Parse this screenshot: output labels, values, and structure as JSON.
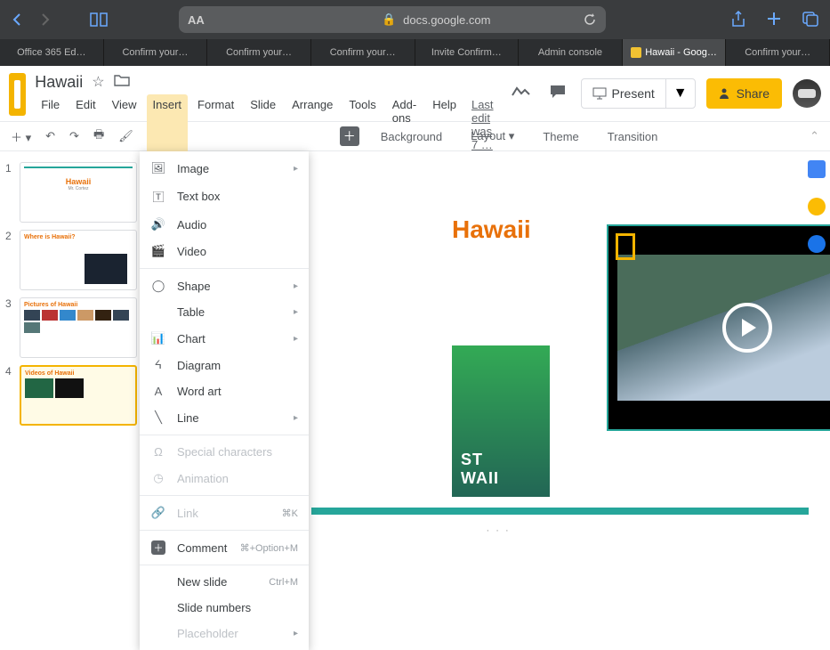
{
  "safari": {
    "url_domain": "docs.google.com",
    "aA": "AA"
  },
  "browser_tabs": [
    {
      "label": "Office 365 Ed…",
      "active": false
    },
    {
      "label": "Confirm your…",
      "active": false
    },
    {
      "label": "Confirm your…",
      "active": false
    },
    {
      "label": "Confirm your…",
      "active": false
    },
    {
      "label": "Invite Confirm…",
      "active": false
    },
    {
      "label": "Admin console",
      "active": false
    },
    {
      "label": "Hawaii - Goog…",
      "active": true
    },
    {
      "label": "Confirm your…",
      "active": false
    }
  ],
  "doc": {
    "title": "Hawaii",
    "last_edit": "Last edit was 7 …"
  },
  "menus": [
    "File",
    "Edit",
    "View",
    "Insert",
    "Format",
    "Slide",
    "Arrange",
    "Tools",
    "Add-ons",
    "Help"
  ],
  "selected_menu_index": 3,
  "toolbar": {
    "background": "Background",
    "layout": "Layout",
    "theme": "Theme",
    "transition": "Transition"
  },
  "header": {
    "present": "Present",
    "share": "Share"
  },
  "insert_menu": [
    {
      "icon": "image-icon",
      "label": "Image",
      "submenu": true
    },
    {
      "icon": "textbox-icon",
      "label": "Text box"
    },
    {
      "icon": "audio-icon",
      "label": "Audio"
    },
    {
      "icon": "video-icon",
      "label": "Video"
    },
    {
      "sep": true
    },
    {
      "icon": "shape-icon",
      "label": "Shape",
      "submenu": true
    },
    {
      "icon": "table-icon",
      "label": "Table",
      "submenu": true,
      "indent": true
    },
    {
      "icon": "chart-icon",
      "label": "Chart",
      "submenu": true
    },
    {
      "icon": "diagram-icon",
      "label": "Diagram"
    },
    {
      "icon": "wordart-icon",
      "label": "Word art"
    },
    {
      "icon": "line-icon",
      "label": "Line",
      "submenu": true
    },
    {
      "sep": true
    },
    {
      "icon": "omega-icon",
      "label": "Special characters",
      "disabled": true
    },
    {
      "icon": "animation-icon",
      "label": "Animation",
      "disabled": true
    },
    {
      "sep": true
    },
    {
      "icon": "link-icon",
      "label": "Link",
      "shortcut": "⌘K",
      "disabled": true
    },
    {
      "sep": true
    },
    {
      "icon": "comment-icon",
      "label": "Comment",
      "shortcut": "⌘+Option+M"
    },
    {
      "sep": true
    },
    {
      "icon": "",
      "label": "New slide",
      "shortcut": "Ctrl+M"
    },
    {
      "icon": "",
      "label": "Slide numbers"
    },
    {
      "icon": "",
      "label": "Placeholder",
      "submenu": true,
      "disabled": true
    }
  ],
  "thumbs": {
    "t1_title": "Hawaii",
    "t1_sub": "Mr. Cortez",
    "t2_title": "Where is Hawaii?",
    "t3_title": "Pictures of Hawaii",
    "t4_title": "Videos of Hawaii"
  },
  "canvas": {
    "headline_fragment": "Hawaii",
    "overlay_text": "ST\nWAII"
  }
}
